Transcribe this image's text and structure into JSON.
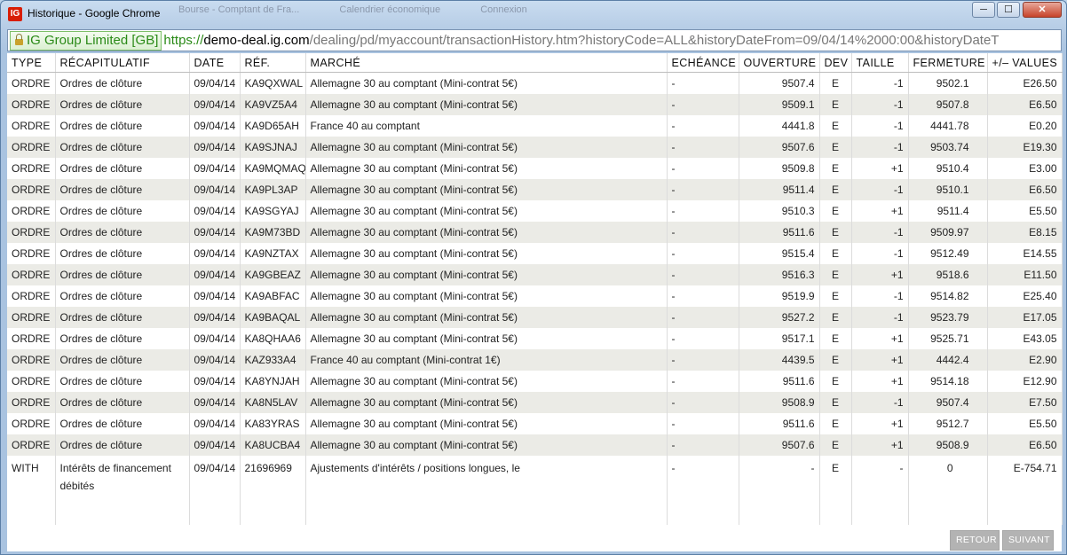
{
  "window": {
    "title": "Historique - Google Chrome",
    "app_icon": "IG",
    "background_tabs": [
      "Bourse - Comptant de Fra...",
      "Calendrier économique",
      "Connexion"
    ],
    "minimize_label": "─",
    "maximize_label": "☐",
    "close_label": "✕"
  },
  "address": {
    "cert_label": "IG Group Limited [GB]",
    "scheme": "https://",
    "host": "demo-deal.ig.com",
    "path": "/dealing/pd/myaccount/transactionHistory.htm?historyCode=ALL&historyDateFrom=09/04/14%2000:00&historyDateT"
  },
  "table": {
    "headers": [
      "TYPE",
      "RÉCAPITULATIF",
      "DATE",
      "RÉF.",
      "MARCHÉ",
      "ECHÉANCE",
      "OUVERTURE",
      "DEV",
      "TAILLE",
      "FERMETURE",
      "+/– VALUES"
    ],
    "rows": [
      [
        "ORDRE",
        "Ordres de clôture",
        "09/04/14",
        "KA9QXWAL",
        "Allemagne 30 au comptant (Mini-contrat 5€)",
        "-",
        "9507.4",
        "E",
        "-1",
        "9502.1",
        "E26.50"
      ],
      [
        "ORDRE",
        "Ordres de clôture",
        "09/04/14",
        "KA9VZ5A4",
        "Allemagne 30 au comptant (Mini-contrat 5€)",
        "-",
        "9509.1",
        "E",
        "-1",
        "9507.8",
        "E6.50"
      ],
      [
        "ORDRE",
        "Ordres de clôture",
        "09/04/14",
        "KA9D65AH",
        "France 40 au comptant",
        "-",
        "4441.8",
        "E",
        "-1",
        "4441.78",
        "E0.20"
      ],
      [
        "ORDRE",
        "Ordres de clôture",
        "09/04/14",
        "KA9SJNAJ",
        "Allemagne 30 au comptant (Mini-contrat 5€)",
        "-",
        "9507.6",
        "E",
        "-1",
        "9503.74",
        "E19.30"
      ],
      [
        "ORDRE",
        "Ordres de clôture",
        "09/04/14",
        "KA9MQMAQ",
        "Allemagne 30 au comptant (Mini-contrat 5€)",
        "-",
        "9509.8",
        "E",
        "+1",
        "9510.4",
        "E3.00"
      ],
      [
        "ORDRE",
        "Ordres de clôture",
        "09/04/14",
        "KA9PL3AP",
        "Allemagne 30 au comptant (Mini-contrat 5€)",
        "-",
        "9511.4",
        "E",
        "-1",
        "9510.1",
        "E6.50"
      ],
      [
        "ORDRE",
        "Ordres de clôture",
        "09/04/14",
        "KA9SGYAJ",
        "Allemagne 30 au comptant (Mini-contrat 5€)",
        "-",
        "9510.3",
        "E",
        "+1",
        "9511.4",
        "E5.50"
      ],
      [
        "ORDRE",
        "Ordres de clôture",
        "09/04/14",
        "KA9M73BD",
        "Allemagne 30 au comptant (Mini-contrat 5€)",
        "-",
        "9511.6",
        "E",
        "-1",
        "9509.97",
        "E8.15"
      ],
      [
        "ORDRE",
        "Ordres de clôture",
        "09/04/14",
        "KA9NZTAX",
        "Allemagne 30 au comptant (Mini-contrat 5€)",
        "-",
        "9515.4",
        "E",
        "-1",
        "9512.49",
        "E14.55"
      ],
      [
        "ORDRE",
        "Ordres de clôture",
        "09/04/14",
        "KA9GBEAZ",
        "Allemagne 30 au comptant (Mini-contrat 5€)",
        "-",
        "9516.3",
        "E",
        "+1",
        "9518.6",
        "E11.50"
      ],
      [
        "ORDRE",
        "Ordres de clôture",
        "09/04/14",
        "KA9ABFAC",
        "Allemagne 30 au comptant (Mini-contrat 5€)",
        "-",
        "9519.9",
        "E",
        "-1",
        "9514.82",
        "E25.40"
      ],
      [
        "ORDRE",
        "Ordres de clôture",
        "09/04/14",
        "KA9BAQAL",
        "Allemagne 30 au comptant (Mini-contrat 5€)",
        "-",
        "9527.2",
        "E",
        "-1",
        "9523.79",
        "E17.05"
      ],
      [
        "ORDRE",
        "Ordres de clôture",
        "09/04/14",
        "KA8QHAA6",
        "Allemagne 30 au comptant (Mini-contrat 5€)",
        "-",
        "9517.1",
        "E",
        "+1",
        "9525.71",
        "E43.05"
      ],
      [
        "ORDRE",
        "Ordres de clôture",
        "09/04/14",
        "KAZ933A4",
        "France 40 au comptant (Mini-contrat 1€)",
        "-",
        "4439.5",
        "E",
        "+1",
        "4442.4",
        "E2.90"
      ],
      [
        "ORDRE",
        "Ordres de clôture",
        "09/04/14",
        "KA8YNJAH",
        "Allemagne 30 au comptant (Mini-contrat 5€)",
        "-",
        "9511.6",
        "E",
        "+1",
        "9514.18",
        "E12.90"
      ],
      [
        "ORDRE",
        "Ordres de clôture",
        "09/04/14",
        "KA8N5LAV",
        "Allemagne 30 au comptant (Mini-contrat 5€)",
        "-",
        "9508.9",
        "E",
        "-1",
        "9507.4",
        "E7.50"
      ],
      [
        "ORDRE",
        "Ordres de clôture",
        "09/04/14",
        "KA83YRAS",
        "Allemagne 30 au comptant (Mini-contrat 5€)",
        "-",
        "9511.6",
        "E",
        "+1",
        "9512.7",
        "E5.50"
      ],
      [
        "ORDRE",
        "Ordres de clôture",
        "09/04/14",
        "KA8UCBA4",
        "Allemagne 30 au comptant (Mini-contrat 5€)",
        "-",
        "9507.6",
        "E",
        "+1",
        "9508.9",
        "E6.50"
      ]
    ],
    "last_row": [
      "WITH",
      "Intérêts de financement débités",
      "09/04/14",
      "21696969",
      "Ajustements d'intérêts / positions longues, le",
      "-",
      "-",
      "E",
      "-",
      "0",
      "E-754.71"
    ]
  },
  "buttons": {
    "back_label": "RETOUR",
    "next_label": "SUIVANT"
  },
  "colors": {
    "alt_row": "#ebebe6",
    "secure_green": "#2a8a17",
    "button_grey": "#b3b3b3"
  }
}
